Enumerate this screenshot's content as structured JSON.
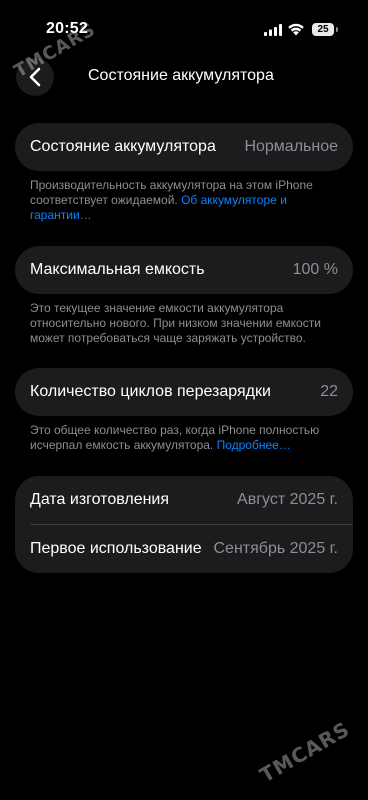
{
  "status_bar": {
    "time": "20:52",
    "battery": "25"
  },
  "nav": {
    "title": "Состояние аккумулятора"
  },
  "health_card": {
    "label": "Состояние аккумулятора",
    "value": "Нормальное"
  },
  "health_note": {
    "text": "Производительность аккумулятора на этом iPhone соответствует ожидаемой. ",
    "link": "Об аккумуляторе и гарантии…"
  },
  "capacity_card": {
    "label": "Максимальная емкость",
    "value": "100 %"
  },
  "capacity_note": {
    "text": "Это текущее значение емкости аккумулятора относительно нового. При низком значении емкости может потребоваться чаще заряжать устройство."
  },
  "cycles_card": {
    "label": "Количество циклов перезарядки",
    "value": "22"
  },
  "cycles_note": {
    "text": "Это общее количество раз, когда iPhone полностью исчерпал емкость аккумулятора. ",
    "link": "Подробнее…"
  },
  "dates_card": {
    "manufacture_label": "Дата изготовления",
    "manufacture_value": "Август 2025 г.",
    "first_use_label": "Первое использование",
    "first_use_value": "Сентябрь 2025 г."
  },
  "watermark": "TMCARS",
  "icons": {
    "back": "chevron-left-icon",
    "signal": "cellular-signal-icon",
    "wifi": "wifi-icon",
    "battery": "battery-icon"
  }
}
